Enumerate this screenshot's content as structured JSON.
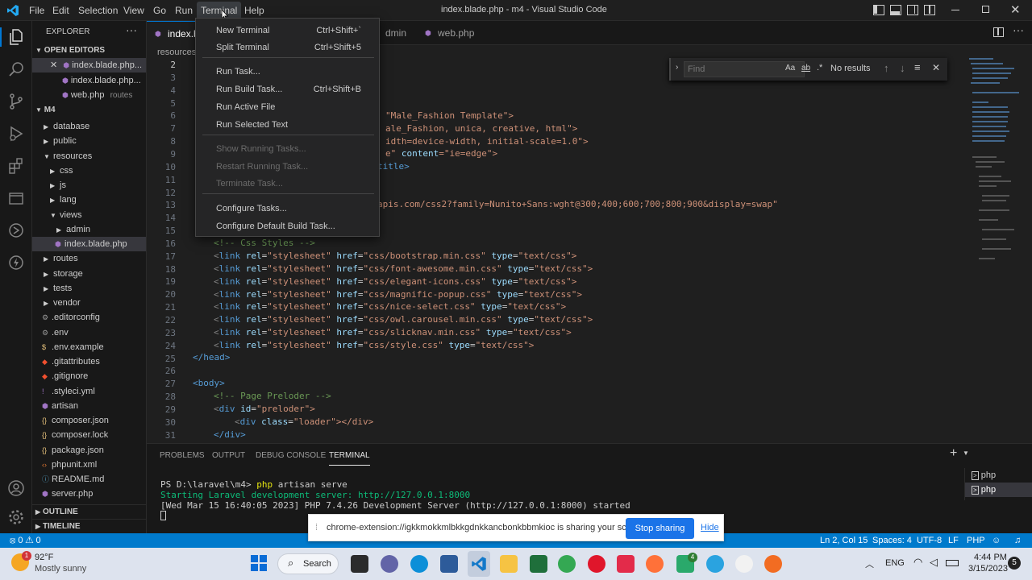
{
  "titlebar": {
    "title": "index.blade.php - m4 - Visual Studio Code",
    "menus": [
      "File",
      "Edit",
      "Selection",
      "View",
      "Go",
      "Run",
      "Terminal",
      "Help"
    ]
  },
  "terminal_menu": {
    "items": [
      {
        "label": "New Terminal",
        "shortcut": "Ctrl+Shift+`",
        "enabled": true
      },
      {
        "label": "Split Terminal",
        "shortcut": "Ctrl+Shift+5",
        "enabled": true
      },
      {
        "label": "Run Task...",
        "shortcut": "",
        "enabled": true
      },
      {
        "label": "Run Build Task...",
        "shortcut": "Ctrl+Shift+B",
        "enabled": true
      },
      {
        "label": "Run Active File",
        "shortcut": "",
        "enabled": true
      },
      {
        "label": "Run Selected Text",
        "shortcut": "",
        "enabled": true
      },
      {
        "label": "Show Running Tasks...",
        "shortcut": "",
        "enabled": false
      },
      {
        "label": "Restart Running Task...",
        "shortcut": "",
        "enabled": false
      },
      {
        "label": "Terminate Task...",
        "shortcut": "",
        "enabled": false
      },
      {
        "label": "Configure Tasks...",
        "shortcut": "",
        "enabled": true
      },
      {
        "label": "Configure Default Build Task...",
        "shortcut": "",
        "enabled": true
      }
    ]
  },
  "sidebar": {
    "title": "EXPLORER",
    "open_editors_header": "OPEN EDITORS",
    "open_editors": [
      {
        "label": "index.blade.php...",
        "detail": ""
      },
      {
        "label": "index.blade.php...",
        "detail": ""
      },
      {
        "label": "web.php",
        "detail": "routes"
      }
    ],
    "project_header": "M4",
    "tree": [
      {
        "label": "database",
        "type": "folder",
        "depth": 0
      },
      {
        "label": "public",
        "type": "folder",
        "depth": 0
      },
      {
        "label": "resources",
        "type": "folder-open",
        "depth": 0
      },
      {
        "label": "css",
        "type": "folder",
        "depth": 1
      },
      {
        "label": "js",
        "type": "folder",
        "depth": 1
      },
      {
        "label": "lang",
        "type": "folder",
        "depth": 1
      },
      {
        "label": "views",
        "type": "folder-open",
        "depth": 1
      },
      {
        "label": "admin",
        "type": "folder",
        "depth": 2
      },
      {
        "label": "index.blade.php",
        "type": "php",
        "depth": 2
      },
      {
        "label": "routes",
        "type": "folder",
        "depth": 0
      },
      {
        "label": "storage",
        "type": "folder",
        "depth": 0
      },
      {
        "label": "tests",
        "type": "folder",
        "depth": 0
      },
      {
        "label": "vendor",
        "type": "folder",
        "depth": 0
      },
      {
        "label": ".editorconfig",
        "type": "gear",
        "depth": 0
      },
      {
        "label": ".env",
        "type": "gear",
        "depth": 0
      },
      {
        "label": ".env.example",
        "type": "dollar",
        "depth": 0
      },
      {
        "label": ".gitattributes",
        "type": "git",
        "depth": 0
      },
      {
        "label": ".gitignore",
        "type": "git",
        "depth": 0
      },
      {
        "label": ".styleci.yml",
        "type": "yml",
        "depth": 0
      },
      {
        "label": "artisan",
        "type": "php",
        "depth": 0
      },
      {
        "label": "composer.json",
        "type": "json",
        "depth": 0
      },
      {
        "label": "composer.lock",
        "type": "json",
        "depth": 0
      },
      {
        "label": "package.json",
        "type": "json",
        "depth": 0
      },
      {
        "label": "phpunit.xml",
        "type": "xml",
        "depth": 0
      },
      {
        "label": "README.md",
        "type": "md",
        "depth": 0
      },
      {
        "label": "server.php",
        "type": "php",
        "depth": 0
      }
    ],
    "outline_header": "OUTLINE",
    "timeline_header": "TIMELINE"
  },
  "tabs": [
    {
      "label": "index.b",
      "active": true
    },
    {
      "label": "dmin",
      "active": false
    },
    {
      "label": "web.php",
      "active": false
    }
  ],
  "breadcrumb": "resources",
  "find": {
    "placeholder": "Find",
    "opt_case": "Aa",
    "opt_word": "ab",
    "opt_regex": ".*",
    "result": "No results"
  },
  "code": {
    "line_numbers": [
      "2",
      "3",
      "4",
      "5",
      "6",
      "7",
      "8",
      "9",
      "10",
      "11",
      "12",
      "13",
      "14",
      "15",
      "16",
      "17",
      "18",
      "19",
      "20",
      "21",
      "22",
      "23",
      "24",
      "25",
      "26",
      "27",
      "28",
      "29",
      "30",
      "31"
    ],
    "fragments": {
      "l6": "\"Male_Fashion Template\">",
      "l7": "ale_Fashion, unica, creative, html\">",
      "l8": "idth=device-width, initial-scale=1.0\">",
      "l9a": "e\"",
      "l9b": "content",
      "l9c": "=\"ie=edge\">",
      "l10": "title>",
      "l13": "apis.com/css2?family=Nunito+Sans:wght@300;400;600;700;800;900&display=swap\"",
      "l16": "<!-- Css Styles -->",
      "links": [
        {
          "href": "\"css/bootstrap.min.css\"",
          "type": "\"text/css\">"
        },
        {
          "href": "\"css/font-awesome.min.css\"",
          "type": "\"text/css\">"
        },
        {
          "href": "\"css/elegant-icons.css\"",
          "type": "\"text/css\">"
        },
        {
          "href": "\"css/magnific-popup.css\"",
          "type": "\"text/css\">"
        },
        {
          "href": "\"css/nice-select.css\"",
          "type": "\"text/css\">"
        },
        {
          "href": "\"css/owl.carousel.min.css\"",
          "type": "\"text/css\">"
        },
        {
          "href": "\"css/slicknav.min.css\"",
          "type": "\"text/css\">"
        },
        {
          "href": "\"css/style.css\"",
          "type": "\"text/css\">"
        }
      ],
      "l25": "</head>",
      "l27": "<body>",
      "l28": "<!-- Page Preloder -->",
      "l29": "\"preloder\">",
      "l30": "\"loader\"></div>",
      "l31": "</div>"
    }
  },
  "panel": {
    "tabs": [
      "PROBLEMS",
      "OUTPUT",
      "DEBUG CONSOLE",
      "TERMINAL"
    ],
    "active_tab": "TERMINAL",
    "terminal_lines": [
      "PS D:\\laravel\\m4> php artisan serve",
      "Starting Laravel development server: http://127.0.0.1:8000",
      "[Wed Mar 15 16:40:05 2023] PHP 7.4.26 Development Server (http://127.0.0.1:8000) started"
    ],
    "terminal_instances": [
      "php",
      "php"
    ]
  },
  "statusbar": {
    "problems": "⦻ 0 ⚠ 0",
    "position": "Ln 2, Col 15",
    "spaces": "Spaces: 4",
    "encoding": "UTF-8",
    "eol": "LF",
    "language": "PHP"
  },
  "share_bar": {
    "message": "chrome-extension://igkkmokkmlbkkgdnkkancbonkbbmkioc is sharing your screen.",
    "stop_label": "Stop sharing",
    "hide_label": "Hide"
  },
  "taskbar": {
    "weather_temp": "92°F",
    "weather_desc": "Mostly sunny",
    "weather_badge": "1",
    "search_label": "Search",
    "lang": "ENG",
    "time": "4:44 PM",
    "date": "3/15/2023",
    "notif_badge": "5",
    "app_badge": "4"
  },
  "colors": {
    "accent": "#007acc",
    "tag": "#569cd6",
    "attr": "#9cdcfe",
    "string": "#ce9178",
    "comment": "#6a9955"
  }
}
